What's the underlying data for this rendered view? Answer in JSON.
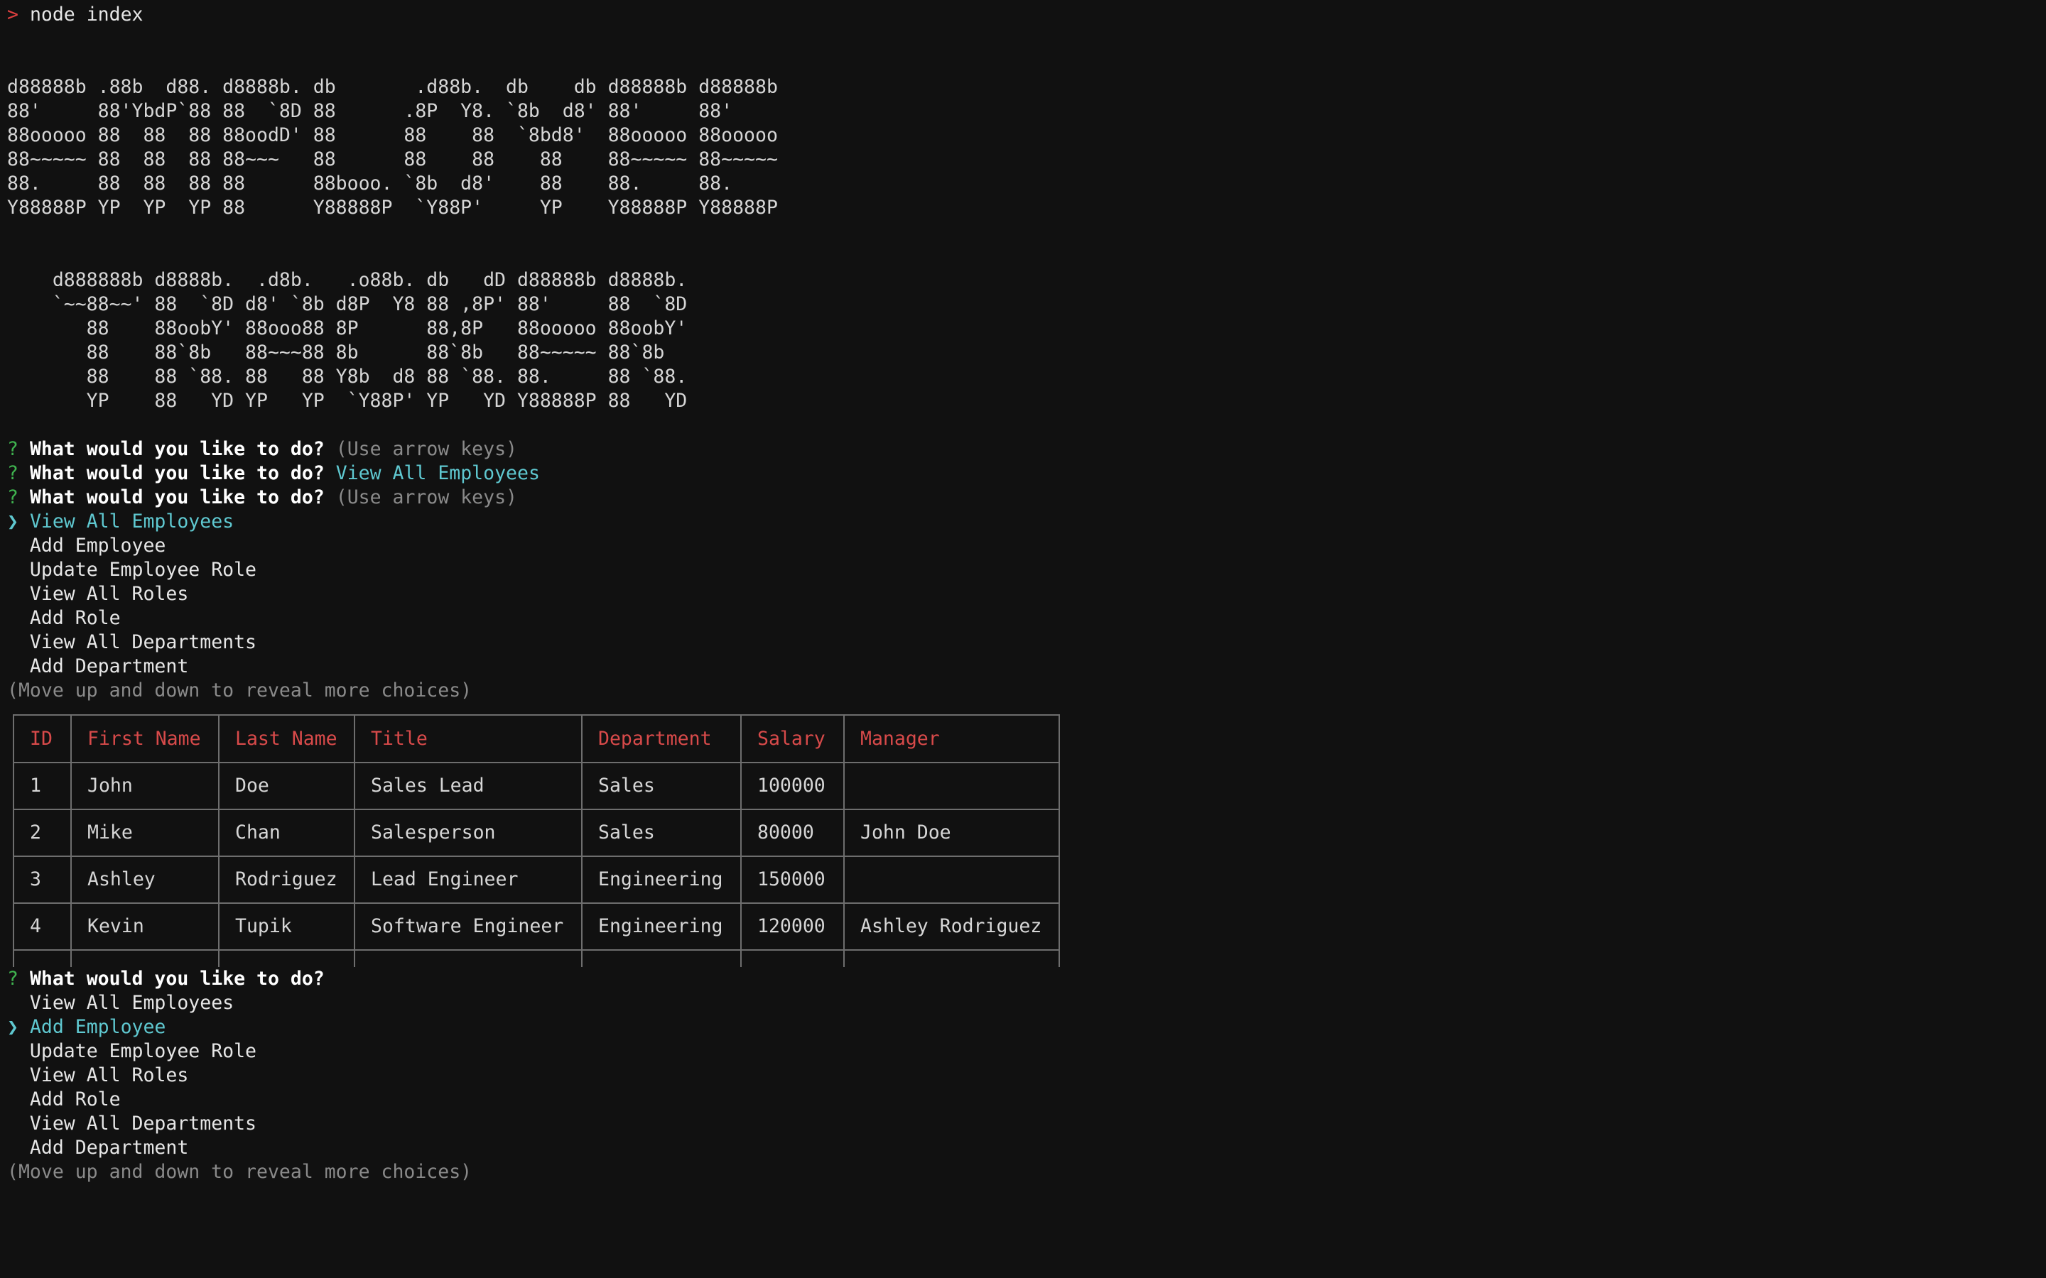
{
  "prompt_symbol": ">",
  "command": "node index",
  "banner_top": [
    "d88888b .88b  d88. d8888b. db       .d88b.  db    db d88888b d88888b",
    "88'     88'YbdP`88 88  `8D 88      .8P  Y8. `8b  d8' 88'     88'",
    "88ooooo 88  88  88 88oodD' 88      88    88  `8bd8'  88ooooo 88ooooo",
    "88~~~~~ 88  88  88 88~~~   88      88    88    88    88~~~~~ 88~~~~~",
    "88.     88  88  88 88      88booo. `8b  d8'    88    88.     88.",
    "Y88888P YP  YP  YP 88      Y88888P  `Y88P'     YP    Y88888P Y88888P"
  ],
  "banner_bottom": [
    "    d888888b d8888b.  .d8b.   .o88b. db   dD d88888b d8888b.",
    "    `~~88~~' 88  `8D d8' `8b d8P  Y8 88 ,8P' 88'     88  `8D",
    "       88    88oobY' 88ooo88 8P      88,8P   88ooooo 88oobY'",
    "       88    88`8b   88~~~88 8b      88`8b   88~~~~~ 88`8b",
    "       88    88 `88. 88   88 Y8b  d8 88 `88. 88.     88 `88.",
    "       YP    88   YD YP   YP  `Y88P' YP   YD Y88888P 88   YD"
  ],
  "question_mark": "?",
  "question": "What would you like to do?",
  "hint_arrow": "(Use arrow keys)",
  "answer_1": "View All Employees",
  "pointer": "❯",
  "menu_1": {
    "items": [
      "View All Employees",
      "Add Employee",
      "Update Employee Role",
      "View All Roles",
      "Add Role",
      "View All Departments",
      "Add Department"
    ],
    "selected_index": 0
  },
  "more_choices": "(Move up and down to reveal more choices)",
  "table": {
    "headers": [
      "ID",
      "First Name",
      "Last Name",
      "Title",
      "Department",
      "Salary",
      "Manager"
    ],
    "rows": [
      [
        "1",
        "John",
        "Doe",
        "Sales Lead",
        "Sales",
        "100000",
        ""
      ],
      [
        "2",
        "Mike",
        "Chan",
        "Salesperson",
        "Sales",
        "80000",
        "John Doe"
      ],
      [
        "3",
        "Ashley",
        "Rodriguez",
        "Lead Engineer",
        "Engineering",
        "150000",
        ""
      ],
      [
        "4",
        "Kevin",
        "Tupik",
        "Software Engineer",
        "Engineering",
        "120000",
        "Ashley Rodriguez"
      ]
    ]
  },
  "menu_2": {
    "items": [
      "View All Employees",
      "Add Employee",
      "Update Employee Role",
      "View All Roles",
      "Add Role",
      "View All Departments",
      "Add Department"
    ],
    "selected_index": 1
  },
  "colors": {
    "background": "#111111",
    "prompt_red": "#e04040",
    "question_green": "#3fb34f",
    "selected_cyan": "#5fc8d0",
    "hint_gray": "#8a8a8a",
    "table_header_red": "#d84a4a"
  }
}
